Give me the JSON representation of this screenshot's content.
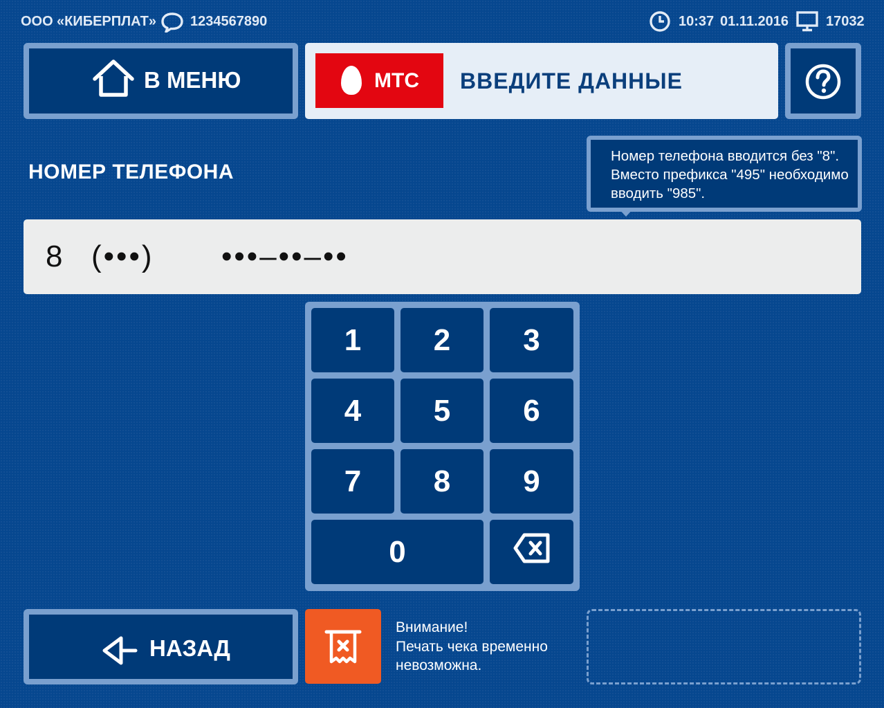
{
  "topbar": {
    "org_prefix": "ООО",
    "org_name": "«КИБЕРПЛАТ»",
    "support_phone": "1234567890",
    "time": "10:37",
    "date": "01.11.2016",
    "terminal_id": "17032",
    "icons": {
      "chat": "chat-bubble-icon",
      "clock": "clock-icon",
      "terminal": "monitor-icon"
    }
  },
  "menu_button": {
    "label": "В МЕНЮ",
    "icon": "home-icon"
  },
  "header": {
    "logo_text": "МТС",
    "title": "ВВЕДИТЕ ДАННЫЕ",
    "logo_color": "#e30611"
  },
  "help_button": {
    "label": "?",
    "icon": "question-icon"
  },
  "field": {
    "label": "НОМЕР ТЕЛЕФОНА",
    "mask_prefix": "8",
    "mask_code": "(•••)",
    "mask_number": "•••–••–••"
  },
  "hint": {
    "text": "Номер телефона вводится без \"8\". Вместо префикса \"495\" необходимо вводить \"985\"."
  },
  "keypad": {
    "keys": [
      "1",
      "2",
      "3",
      "4",
      "5",
      "6",
      "7",
      "8",
      "9",
      "0"
    ],
    "backspace_icon": "backspace-icon"
  },
  "back_button": {
    "label": "НАЗАД",
    "icon": "back-arrow-icon"
  },
  "warning": {
    "icon": "receipt-cancel-icon",
    "line1": "Внимание!",
    "line2": "Печать чека временно",
    "line3": "невозможна.",
    "color": "#f05a23"
  },
  "colors": {
    "background": "#06478f",
    "button": "#003a78",
    "button_border": "#7aa0cf"
  }
}
